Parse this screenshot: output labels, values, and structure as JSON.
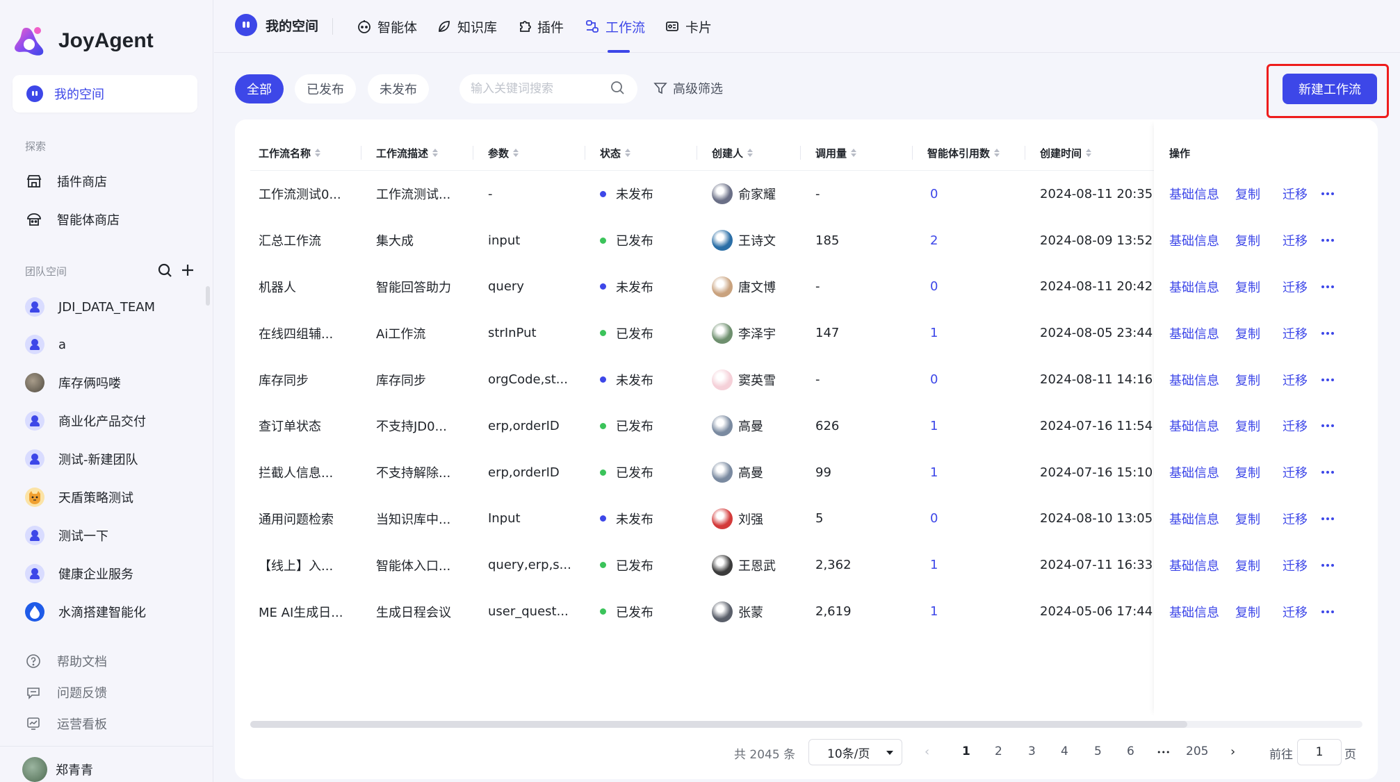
{
  "app": {
    "name": "JoyAgent",
    "brand_color": "#3d47e8"
  },
  "sidebar": {
    "my_space": "我的空间",
    "explore_title": "探索",
    "explore_items": [
      {
        "label": "插件商店",
        "icon": "store-icon"
      },
      {
        "label": "智能体商店",
        "icon": "robot-store-icon"
      }
    ],
    "team_title": "团队空间",
    "teams": [
      {
        "label": "JDI_DATA_TEAM",
        "avatar": "default"
      },
      {
        "label": "a",
        "avatar": "default"
      },
      {
        "label": "库存俩吗喽",
        "avatar": "photo"
      },
      {
        "label": "商业化产品交付",
        "avatar": "default"
      },
      {
        "label": "测试-新建团队",
        "avatar": "default"
      },
      {
        "label": "天盾策略测试",
        "avatar": "cat"
      },
      {
        "label": "测试一下",
        "avatar": "default"
      },
      {
        "label": "健康企业服务",
        "avatar": "default"
      },
      {
        "label": "水滴搭建智能化",
        "avatar": "drop"
      }
    ],
    "bottom_items": [
      {
        "label": "帮助文档",
        "icon": "help-icon"
      },
      {
        "label": "问题反馈",
        "icon": "feedback-icon"
      },
      {
        "label": "运营看板",
        "icon": "dashboard-icon"
      }
    ],
    "user": "郑青青"
  },
  "topnav": {
    "space": "我的空间",
    "tabs": [
      {
        "label": "智能体",
        "icon": "agent-icon"
      },
      {
        "label": "知识库",
        "icon": "knowledge-icon"
      },
      {
        "label": "插件",
        "icon": "plugin-icon"
      },
      {
        "label": "工作流",
        "icon": "workflow-icon",
        "active": true
      },
      {
        "label": "卡片",
        "icon": "card-icon"
      }
    ]
  },
  "filters": {
    "pills": [
      "全部",
      "已发布",
      "未发布"
    ],
    "active": "全部",
    "search_placeholder": "输入关键词搜索",
    "advanced": "高级筛选",
    "new_button": "新建工作流"
  },
  "table": {
    "columns": [
      "工作流名称",
      "工作流描述",
      "参数",
      "状态",
      "创建人",
      "调用量",
      "智能体引用数",
      "创建时间",
      "操作"
    ],
    "actions": [
      "基础信息",
      "复制",
      "迁移"
    ],
    "status_colors": {
      "已发布": "#3bc35a",
      "未发布": "#3d47e8"
    },
    "rows": [
      {
        "name": "工作流测试0...",
        "desc": "工作流测试...",
        "params": "-",
        "status": "未发布",
        "creator": "俞家耀",
        "calls": "-",
        "refs": "0",
        "created": "2024-08-11 20:35:"
      },
      {
        "name": "汇总工作流",
        "desc": "集大成",
        "params": "input",
        "status": "已发布",
        "creator": "王诗文",
        "calls": "185",
        "refs": "2",
        "created": "2024-08-09 13:52"
      },
      {
        "name": "机器人",
        "desc": "智能回答助力",
        "params": "query",
        "status": "未发布",
        "creator": "唐文博",
        "calls": "-",
        "refs": "0",
        "created": "2024-08-11 20:42:"
      },
      {
        "name": "在线四组辅...",
        "desc": "Ai工作流",
        "params": "strInPut",
        "status": "已发布",
        "creator": "李泽宇",
        "calls": "147",
        "refs": "1",
        "created": "2024-08-05 23:44"
      },
      {
        "name": "库存同步",
        "desc": "库存同步",
        "params": "orgCode,st...",
        "status": "未发布",
        "creator": "窦英雪",
        "calls": "-",
        "refs": "0",
        "created": "2024-08-11 14:16:"
      },
      {
        "name": "查订单状态",
        "desc": "不支持JD0...",
        "params": "erp,orderID",
        "status": "已发布",
        "creator": "高曼",
        "calls": "626",
        "refs": "1",
        "created": "2024-07-16 11:54:"
      },
      {
        "name": "拦截人信息...",
        "desc": "不支持解除...",
        "params": "erp,orderID",
        "status": "已发布",
        "creator": "高曼",
        "calls": "99",
        "refs": "1",
        "created": "2024-07-16 15:10:"
      },
      {
        "name": "通用问题检索",
        "desc": "当知识库中...",
        "params": "Input",
        "status": "未发布",
        "creator": "刘强",
        "calls": "5",
        "refs": "0",
        "created": "2024-08-10 13:05:"
      },
      {
        "name": "【线上】入...",
        "desc": "智能体入口...",
        "params": "query,erp,s...",
        "status": "已发布",
        "creator": "王恩武",
        "calls": "2,362",
        "refs": "1",
        "created": "2024-07-11 16:33:"
      },
      {
        "name": "ME AI生成日...",
        "desc": "生成日程会议",
        "params": "user_quest...",
        "status": "已发布",
        "creator": "张蒙",
        "calls": "2,619",
        "refs": "1",
        "created": "2024-05-06 17:44"
      }
    ]
  },
  "pagination": {
    "total": "共 2045 条",
    "page_size": "10条/页",
    "pages": [
      "1",
      "2",
      "3",
      "4",
      "5",
      "6"
    ],
    "ellipsis": "•••",
    "last_page": "205",
    "current": "1",
    "goto_label": "前往",
    "goto_value": "1",
    "goto_suffix": "页"
  }
}
